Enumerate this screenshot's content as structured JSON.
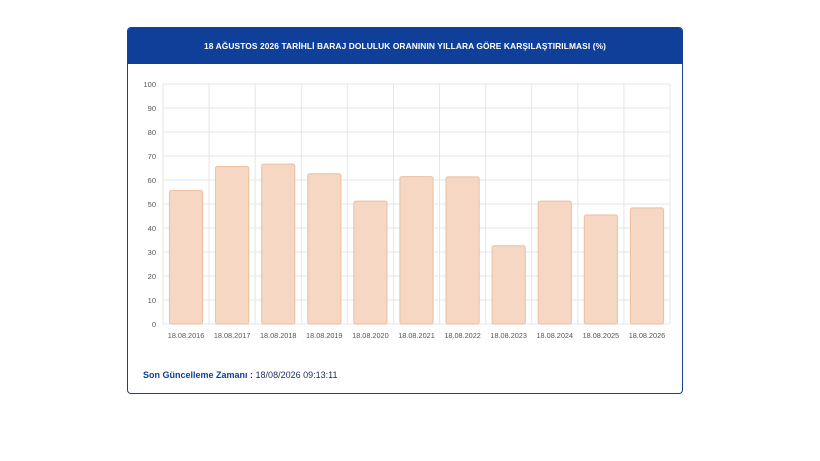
{
  "header": {
    "title": "18 AĞUSTOS 2026 TARİHLİ BARAJ DOLULUK ORANININ YILLARA GÖRE KARŞILAŞTIRILMASI (%)"
  },
  "footer": {
    "label": "Son Güncelleme Zamanı :",
    "value": "18/08/2026 09:13:11"
  },
  "chart_data": {
    "type": "bar",
    "title": "18 AĞUSTOS 2026 TARİHLİ BARAJ DOLULUK ORANININ YILLARA GÖRE KARŞILAŞTIRILMASI (%)",
    "xlabel": "",
    "ylabel": "",
    "ylim": [
      0,
      100
    ],
    "yticks": [
      0,
      10,
      20,
      30,
      40,
      50,
      60,
      70,
      80,
      90,
      100
    ],
    "grid": true,
    "legend": "none",
    "categories": [
      "18.08.2016",
      "18.08.2017",
      "18.08.2018",
      "18.08.2019",
      "18.08.2020",
      "18.08.2021",
      "18.08.2022",
      "18.08.2023",
      "18.08.2024",
      "18.08.2025",
      "18.08.2026"
    ],
    "values": [
      55.6,
      65.6,
      66.6,
      62.6,
      51.2,
      61.4,
      61.3,
      32.6,
      51.2,
      45.4,
      48.4
    ],
    "colors": {
      "bar_fill": "#f5d7c4",
      "bar_stroke": "#ecbf9f",
      "grid": "#e6e6e6",
      "tick_text": "#555555",
      "header": "#0f3f98"
    }
  }
}
